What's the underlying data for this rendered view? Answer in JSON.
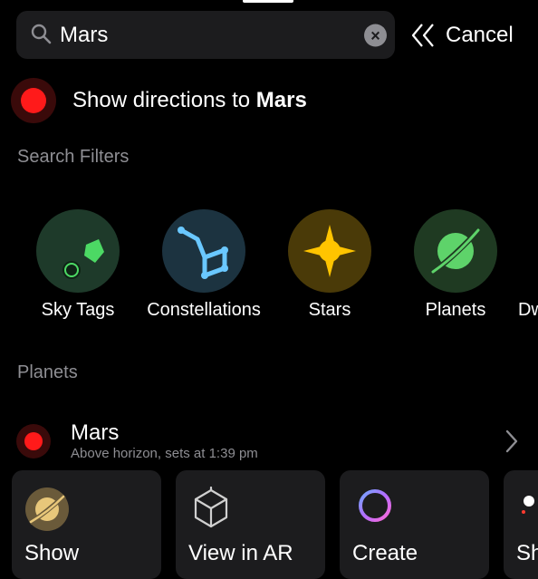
{
  "search": {
    "value": "Mars",
    "placeholder": ""
  },
  "cancel_label": "Cancel",
  "directions": {
    "prefix": "Show directions to ",
    "target": "Mars"
  },
  "sections": {
    "filters_title": "Search Filters",
    "planets_title": "Planets"
  },
  "filters": [
    {
      "label": "Sky Tags",
      "icon": "sky-tags-icon",
      "bg": "#1e3a2a"
    },
    {
      "label": "Constellations",
      "icon": "constellation-icon",
      "bg": "#1c3340"
    },
    {
      "label": "Stars",
      "icon": "star-icon",
      "bg": "#4a3a08"
    },
    {
      "label": "Planets",
      "icon": "planet-icon",
      "bg": "#1f3a22"
    },
    {
      "label": "Dw",
      "icon": "dwarf-planet-icon",
      "bg": "#333"
    }
  ],
  "result": {
    "name": "Mars",
    "subtitle": "Above horizon, sets at 1:39 pm"
  },
  "actions": [
    {
      "label": "Show",
      "icon": "planet-icon"
    },
    {
      "label": "View in AR",
      "icon": "ar-cube-icon"
    },
    {
      "label": "Create",
      "icon": "ring-icon"
    },
    {
      "label": "Sh",
      "icon": "share-icon"
    }
  ],
  "colors": {
    "accent_red": "#ff1a1a",
    "surface": "#1c1c1e",
    "secondary_text": "#8e8e93"
  }
}
